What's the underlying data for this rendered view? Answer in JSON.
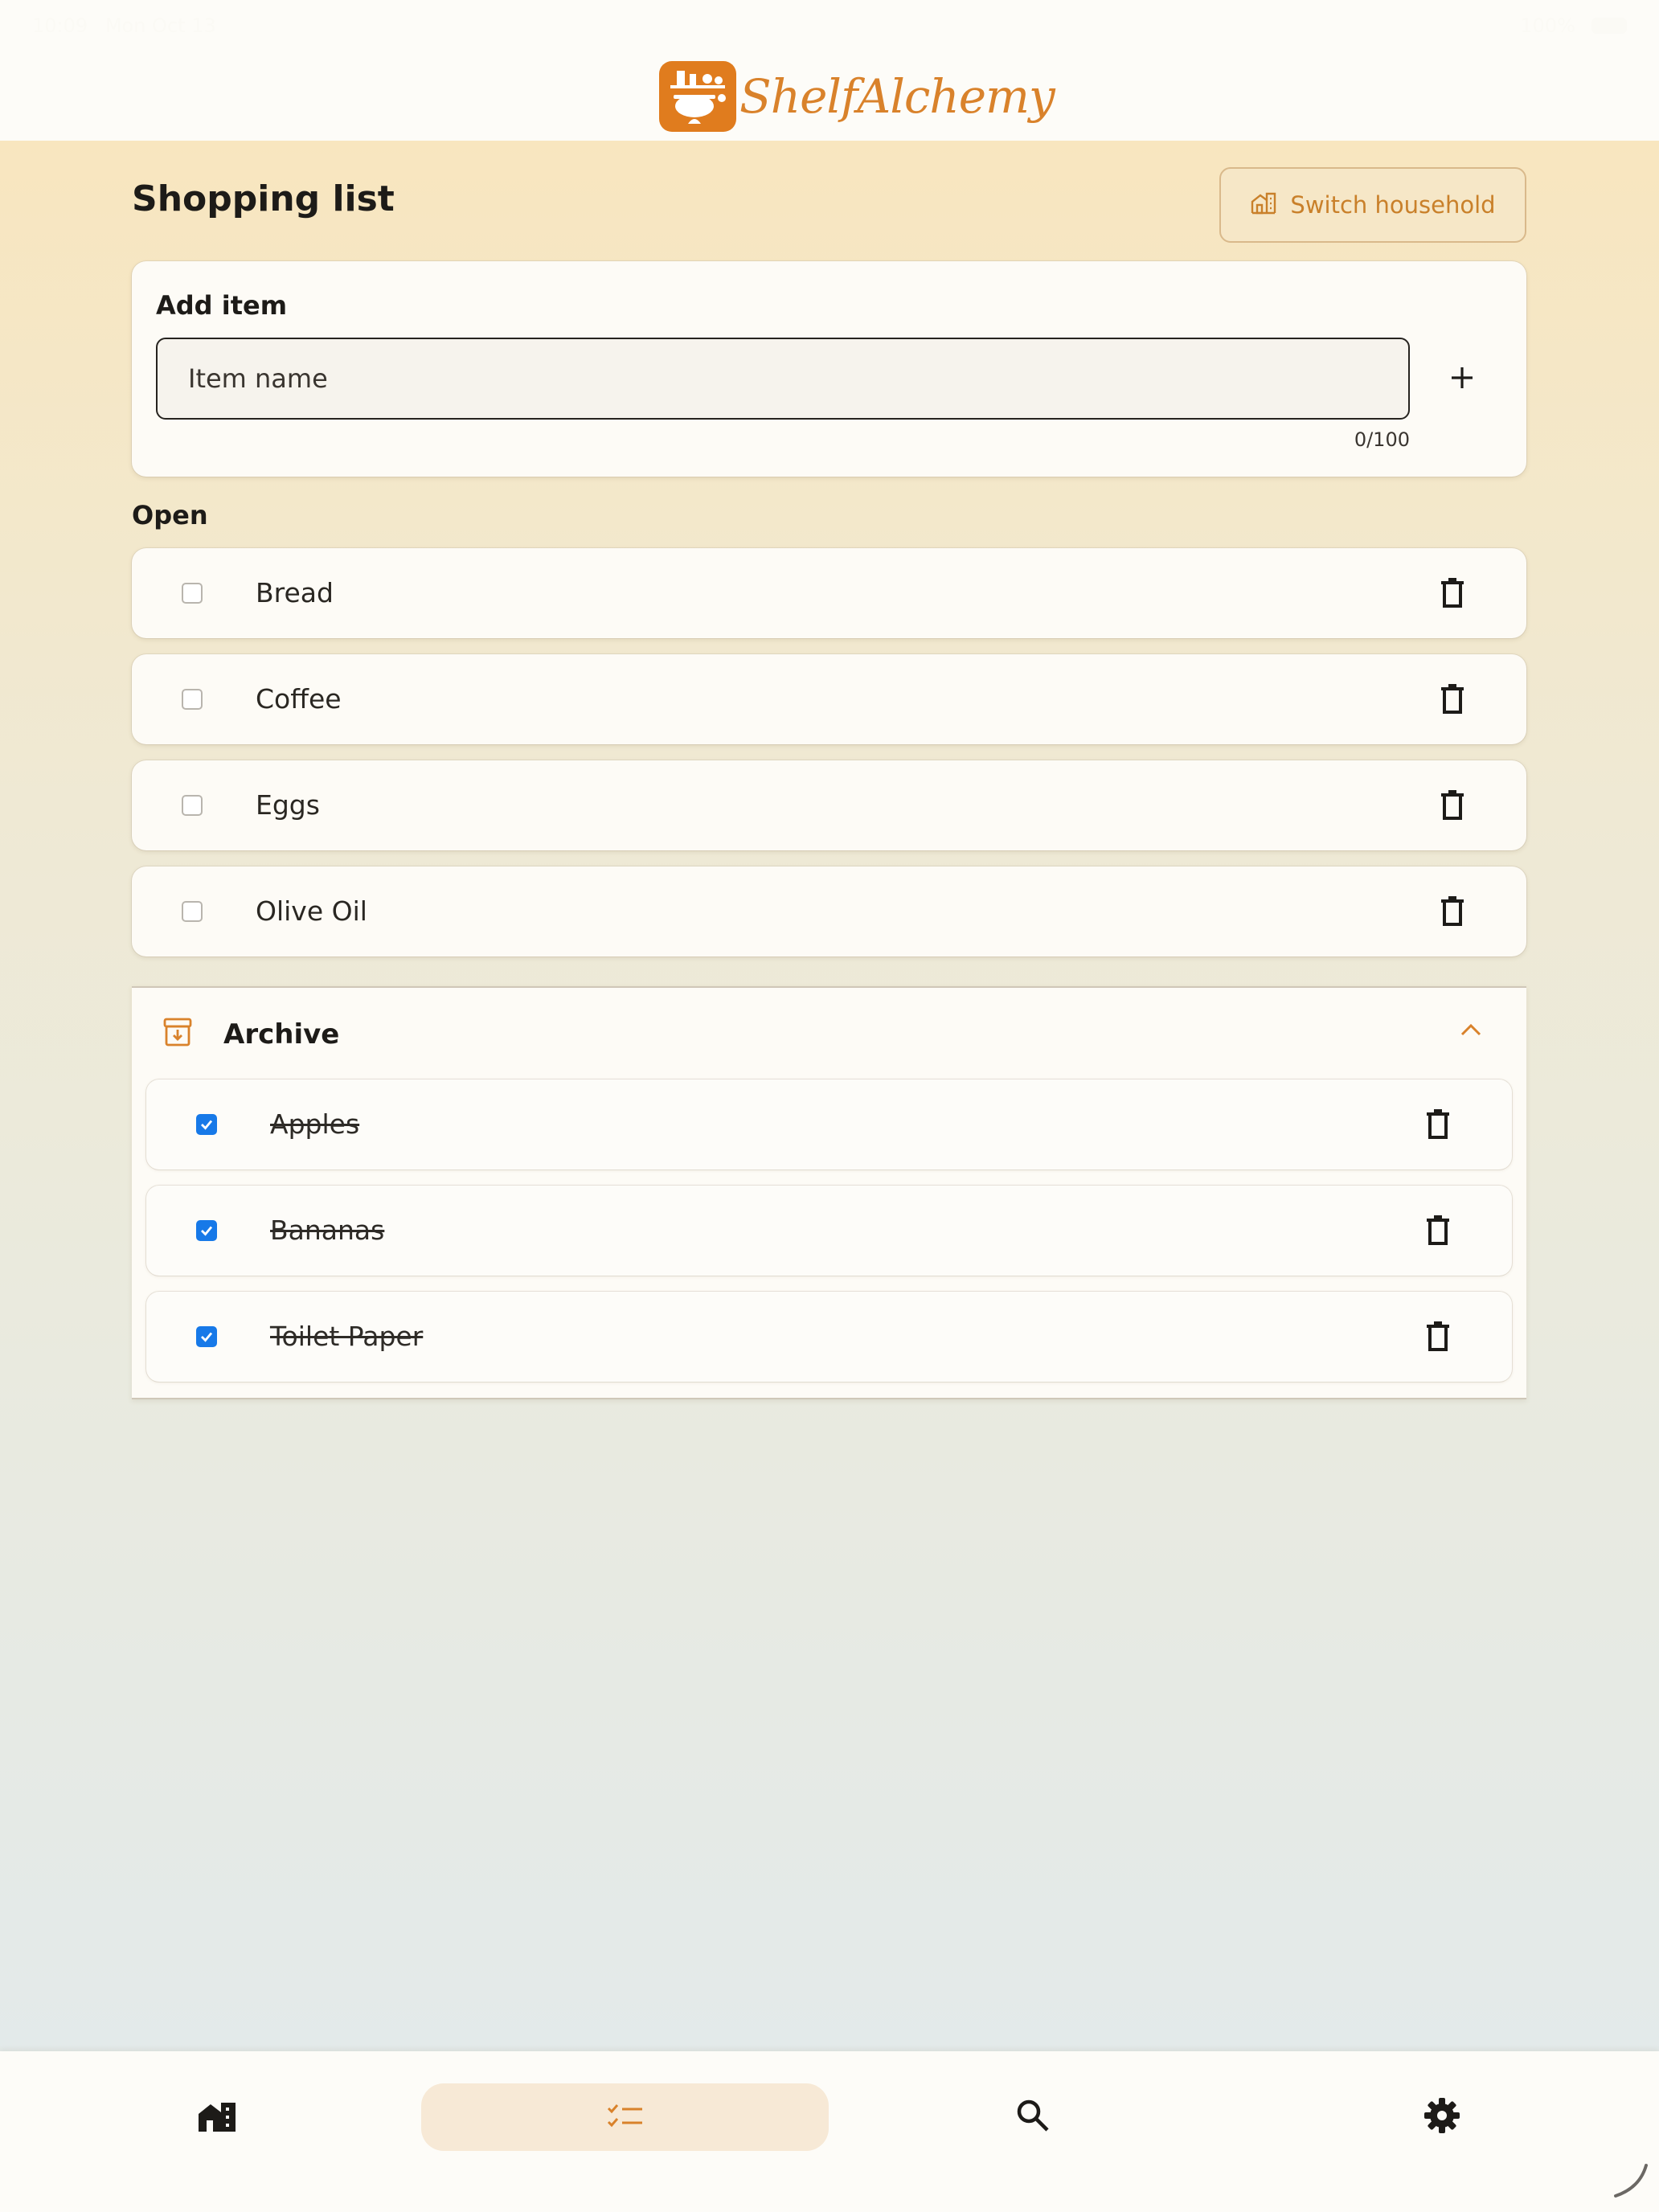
{
  "status_bar": {
    "time": "10:09",
    "date": "Mon Oct 13",
    "battery": "100%"
  },
  "app": {
    "name": "ShelfAlchemy"
  },
  "page": {
    "title": "Shopping list",
    "switch_household_label": "Switch household"
  },
  "add_item": {
    "label": "Add item",
    "input_value": "",
    "input_placeholder": "Item name",
    "counter": "0/100",
    "add_icon": "plus-icon"
  },
  "open_section": {
    "label": "Open",
    "items": [
      {
        "name": "Bread",
        "checked": false
      },
      {
        "name": "Coffee",
        "checked": false
      },
      {
        "name": "Eggs",
        "checked": false
      },
      {
        "name": "Olive Oil",
        "checked": false
      }
    ]
  },
  "archive": {
    "label": "Archive",
    "expanded": true,
    "items": [
      {
        "name": "Apples",
        "checked": true
      },
      {
        "name": "Bananas",
        "checked": true
      },
      {
        "name": "Toilet Paper",
        "checked": true
      }
    ]
  },
  "bottom_nav": {
    "items": [
      {
        "icon": "household-icon",
        "active": false
      },
      {
        "icon": "checklist-icon",
        "active": true
      },
      {
        "icon": "search-icon",
        "active": false
      },
      {
        "icon": "settings-gear-icon",
        "active": false
      }
    ]
  },
  "colors": {
    "accent": "#d9822b",
    "checkbox_checked": "#1779e8",
    "card_bg": "#fdfbf6"
  }
}
